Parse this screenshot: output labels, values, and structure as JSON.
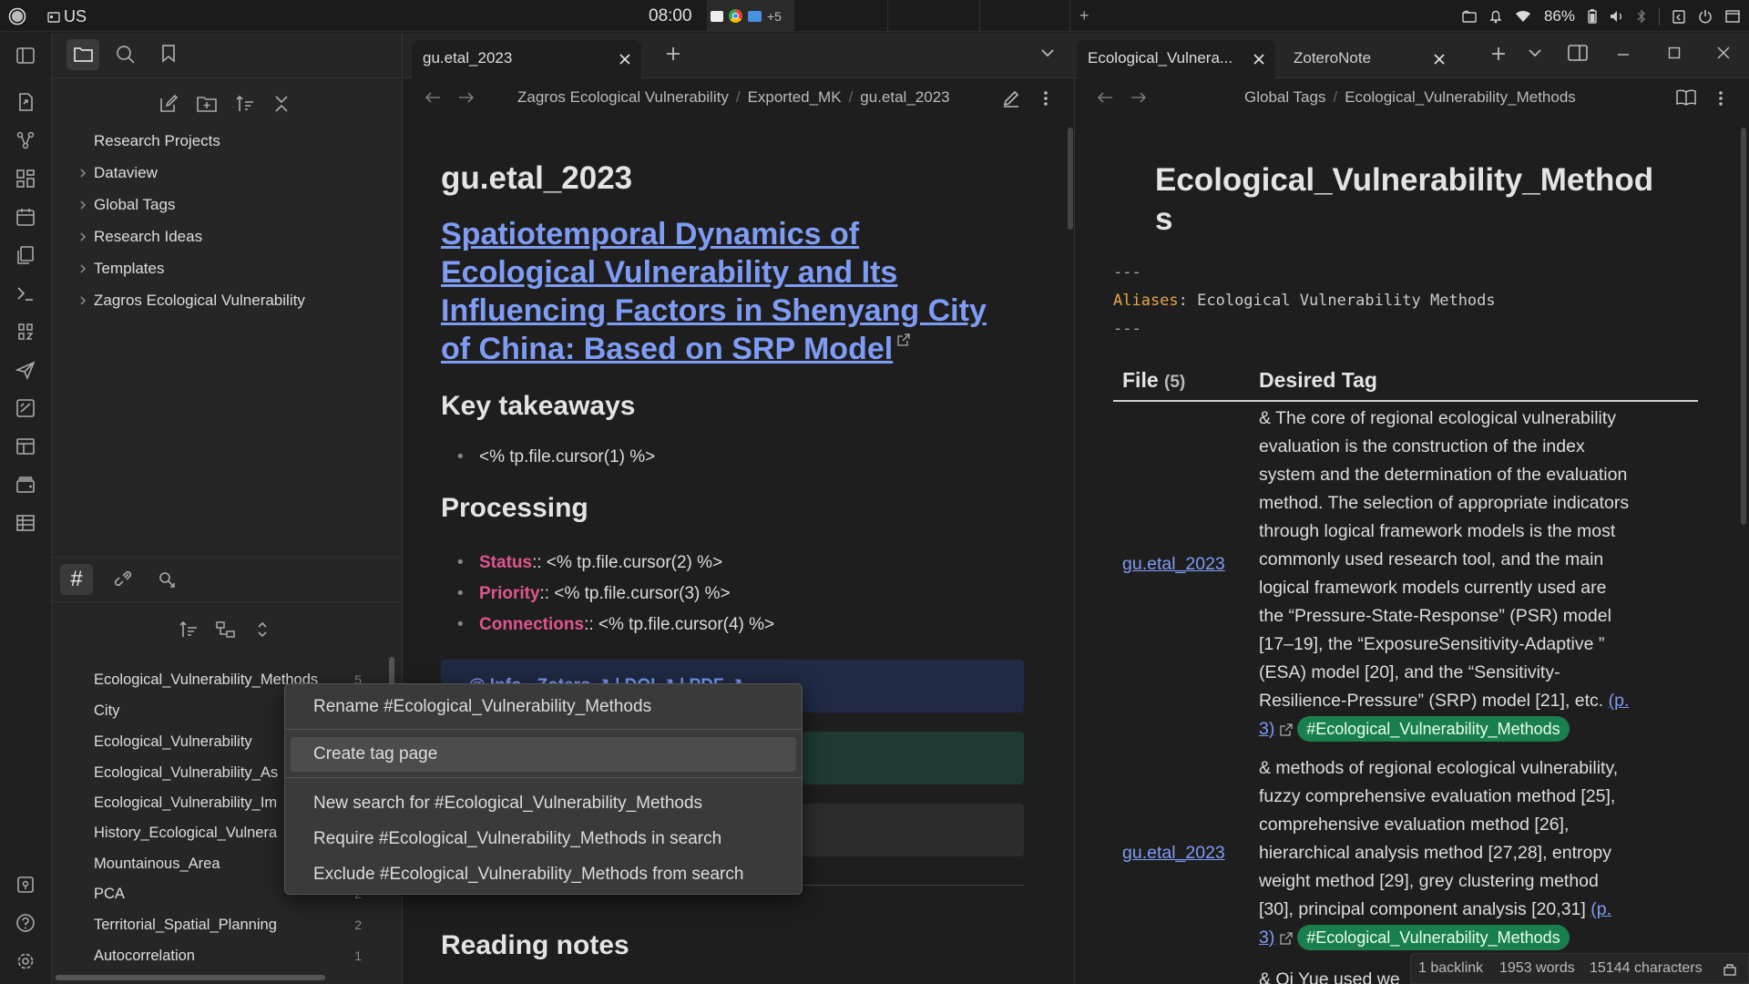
{
  "system_bar": {
    "keyboard_layout": "US",
    "time": "08:00",
    "tray_more": "+5",
    "battery": "86%"
  },
  "left_sidebar": {
    "tree_root": "Research Projects",
    "folders": [
      "Dataview",
      "Global Tags",
      "Research Ideas",
      "Templates",
      "Zagros Ecological Vulnerability"
    ],
    "tags": [
      {
        "name": "Ecological_Vulnerability_Methods",
        "count": "5"
      },
      {
        "name": "City",
        "count": ""
      },
      {
        "name": "Ecological_Vulnerability",
        "count": ""
      },
      {
        "name": "Ecological_Vulnerability_As",
        "count": ""
      },
      {
        "name": "Ecological_Vulnerability_Im",
        "count": ""
      },
      {
        "name": "History_Ecological_Vulnera",
        "count": ""
      },
      {
        "name": "Mountainous_Area",
        "count": ""
      },
      {
        "name": "PCA",
        "count": "2"
      },
      {
        "name": "Territorial_Spatial_Planning",
        "count": "2"
      },
      {
        "name": "Autocorrelation",
        "count": "1"
      }
    ]
  },
  "middle_pane": {
    "tab_title": "gu.etal_2023",
    "breadcrumb": [
      "Zagros Ecological Vulnerability",
      "Exported_MK",
      "gu.etal_2023"
    ],
    "note_title": "gu.etal_2023",
    "paper_title_lines": [
      "Spatiotemporal Dynamics of",
      "Ecological Vulnerability and Its",
      "Influencing Factors in Shenyang City",
      "of China: Based on SRP Model"
    ],
    "h_key_takeaways": "Key takeaways",
    "takeaway_item": "<% tp.file.cursor(1) %>",
    "h_processing": "Processing",
    "props": [
      {
        "key": "Status",
        "value": ":: <% tp.file.cursor(2) %>"
      },
      {
        "key": "Priority",
        "value": ":: <% tp.file.cursor(3) %>"
      },
      {
        "key": "Connections",
        "value": ":: <% tp.file.cursor(4) %>"
      }
    ],
    "callout_partial": "@ Info - Zotero ↗ | DOI ↗ | PDF ↗",
    "h_reading_notes": "Reading notes"
  },
  "right_pane": {
    "tabs": [
      "Ecological_Vulnera...",
      "ZoteroNote"
    ],
    "breadcrumb": [
      "Global Tags",
      "Ecological_Vulnerability_Methods"
    ],
    "title_line1": "Ecological_Vulnerability_Method",
    "title_line2": "s",
    "frontmatter_dash": "---",
    "alias_key": "Aliases",
    "alias_value": ": Ecological Vulnerability Methods",
    "table_header_file": "File",
    "table_header_file_count": "(5)",
    "table_header_tag": "Desired Tag",
    "rows": [
      {
        "file": "gu.etal_2023",
        "lines": [
          "& The core of regional ecological vulnerability",
          "evaluation is the construction of the index",
          "system and the determination of the evaluation",
          "method. The selection of appropriate indicators",
          "through logical framework models is the most",
          "commonly used research tool, and the main",
          "logical framework models currently used are",
          "the “Pressure-State-Response” (PSR) model",
          "[17–19], the “ExposureSensitivity-Adaptive ”",
          "(ESA) model [20], and the “Sensitivity-",
          "Resilience-Pressure” (SRP) model [21], etc."
        ],
        "link_p": "(p.",
        "link_p2": "3)",
        "tag": "#Ecological_Vulnerability_Methods"
      },
      {
        "file": "gu.etal_2023",
        "lines": [
          "& methods of regional ecological vulnerability,",
          "fuzzy comprehensive evaluation method [25],",
          "comprehensive evaluation method [26],",
          "hierarchical analysis method [27,28], entropy",
          "weight method [29], grey clustering method",
          "[30], principal component analysis [20,31]"
        ],
        "link_p": "(p.",
        "link_p2": "3)",
        "tag": "#Ecological_Vulnerability_Methods"
      }
    ],
    "row3_partial": "& Qi Yue used we"
  },
  "context_menu": {
    "items": [
      "Rename #Ecological_Vulnerability_Methods",
      "Create tag page",
      "New search for #Ecological_Vulnerability_Methods",
      "Require #Ecological_Vulnerability_Methods in search",
      "Exclude #Ecological_Vulnerability_Methods from search"
    ]
  },
  "status_bar": {
    "backlinks": "1 backlink",
    "words": "1953 words",
    "characters": "15144 characters"
  }
}
